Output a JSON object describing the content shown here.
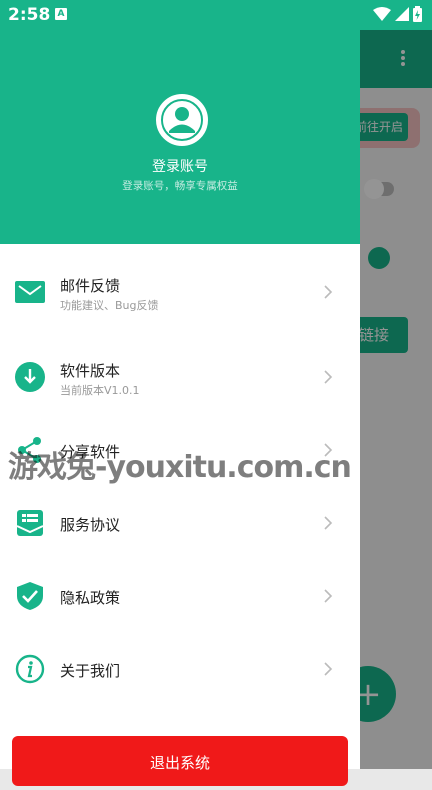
{
  "status_bar": {
    "time": "2:58",
    "indicator": "A"
  },
  "background_app": {
    "open_button_label": "前往开启",
    "connect_button_label": "链接",
    "fab_label": "+"
  },
  "drawer": {
    "header": {
      "title": "登录账号",
      "subtitle": "登录账号，畅享专属权益"
    },
    "items": [
      {
        "title": "邮件反馈",
        "subtitle": "功能建议、Bug反馈",
        "icon": "mail-icon"
      },
      {
        "title": "软件版本",
        "subtitle": "当前版本V1.0.1",
        "icon": "download-icon"
      },
      {
        "title": "分享软件",
        "subtitle": "",
        "icon": "share-icon"
      },
      {
        "title": "服务协议",
        "subtitle": "",
        "icon": "agreement-icon"
      },
      {
        "title": "隐私政策",
        "subtitle": "",
        "icon": "shield-check-icon"
      },
      {
        "title": "关于我们",
        "subtitle": "",
        "icon": "info-icon"
      }
    ],
    "logout_label": "退出系统"
  },
  "watermark": "游戏兔-youxitu.com.cn",
  "colors": {
    "accent": "#18b48a",
    "danger": "#f01919"
  }
}
